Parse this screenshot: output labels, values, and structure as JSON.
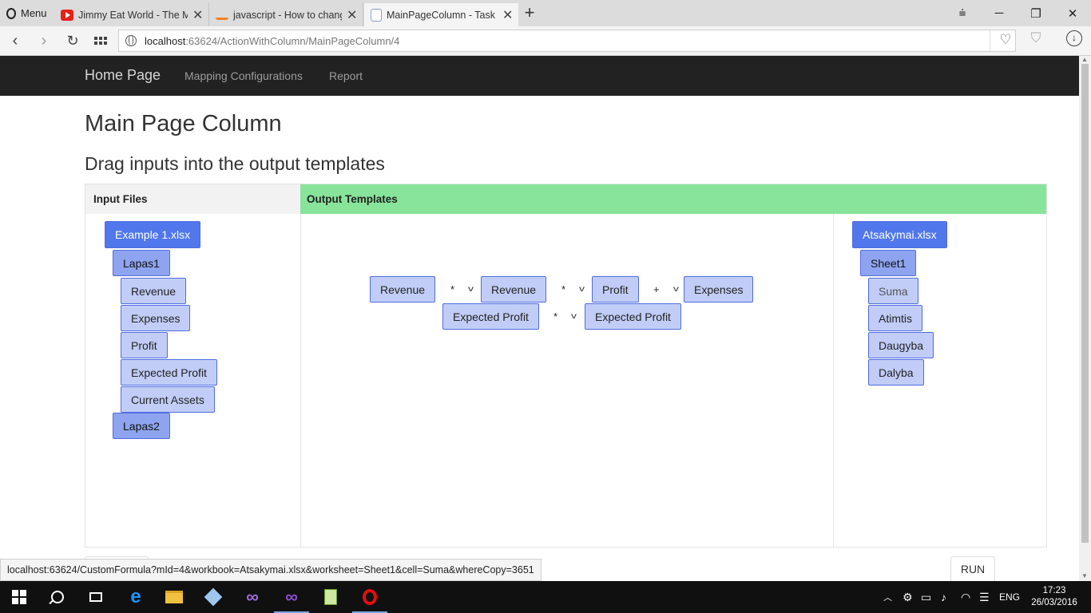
{
  "browser": {
    "menu_label": "Menu",
    "tabs": [
      {
        "title": "Jimmy Eat World - The Mi",
        "icon": "youtube-icon"
      },
      {
        "title": "javascript - How to change",
        "icon": "stackoverflow-icon"
      },
      {
        "title": "MainPageColumn - Task",
        "icon": "page-icon"
      }
    ],
    "url_host": "localhost",
    "url_rest": ":63624/ActionWithColumn/MainPageColumn/4",
    "status_url": "localhost:63624/CustomFormula?mId=4&workbook=Atsakymai.xlsx&worksheet=Sheet1&cell=Suma&whereCopy=3651"
  },
  "navbar": {
    "brand": "Home Page",
    "links": [
      "Mapping Configurations",
      "Report"
    ]
  },
  "page": {
    "title": "Main Page Column",
    "subtitle": "Drag inputs into the output templates",
    "input_header": "Input Files",
    "output_header": "Output Templates",
    "run_label": "RUN"
  },
  "inputs": {
    "file": "Example 1.xlsx",
    "sheet1": "Lapas1",
    "cells": [
      "Revenue",
      "Expenses",
      "Profit",
      "Expected Profit",
      "Current Assets"
    ],
    "sheet2": "Lapas2"
  },
  "formula": {
    "row1": {
      "terms": [
        "Revenue",
        "Revenue",
        "Profit",
        "Expenses"
      ],
      "ops": [
        "*",
        "*",
        "+"
      ]
    },
    "row2": {
      "terms": [
        "Expected Profit",
        "Expected Profit"
      ],
      "ops": [
        "*"
      ]
    }
  },
  "outputs": {
    "file": "Atsakymai.xlsx",
    "sheet": "Sheet1",
    "cells": [
      "Suma",
      "Atimtis",
      "Daugyba",
      "Dalyba"
    ]
  },
  "taskbar": {
    "lang": "ENG",
    "time": "17:23",
    "date": "26/03/2016"
  }
}
